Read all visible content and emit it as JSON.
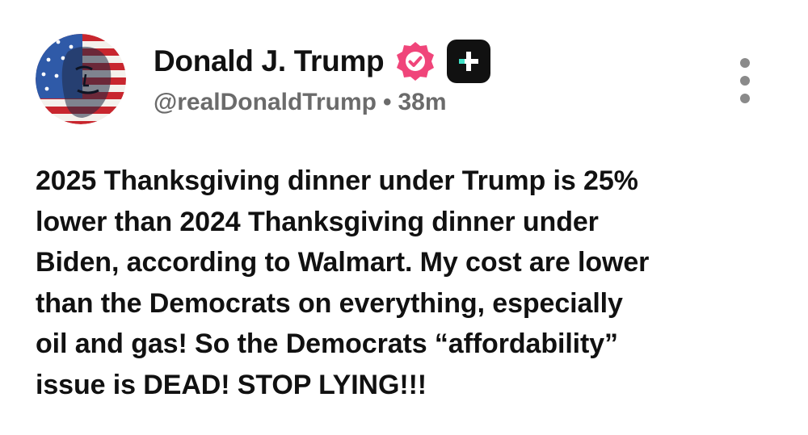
{
  "post": {
    "author": {
      "display_name": "Donald J. Trump",
      "handle": "@realDonaldTrump",
      "separator": "•",
      "time_ago": "38m",
      "verified_icon": "verified-badge-icon",
      "plus_icon": "plus-badge-icon",
      "avatar_icon": "flag-portrait-avatar"
    },
    "menu_icon": "more-vertical-icon",
    "body_lines": [
      "2025 Thanksgiving dinner under Trump is 25%",
      "lower than 2024 Thanksgiving dinner under",
      "Biden, according to Walmart. My cost are lower",
      "than the Democrats on everything, especially",
      "oil and gas! So the Democrats “affordability”",
      "issue is DEAD! STOP LYING!!!"
    ]
  },
  "colors": {
    "text": "#111111",
    "muted": "#6b6b6b",
    "verified_pink": "#f0457a",
    "plus_bg": "#111111",
    "plus_teal": "#3fe0c5",
    "menu_dots": "#8a8a8a"
  }
}
